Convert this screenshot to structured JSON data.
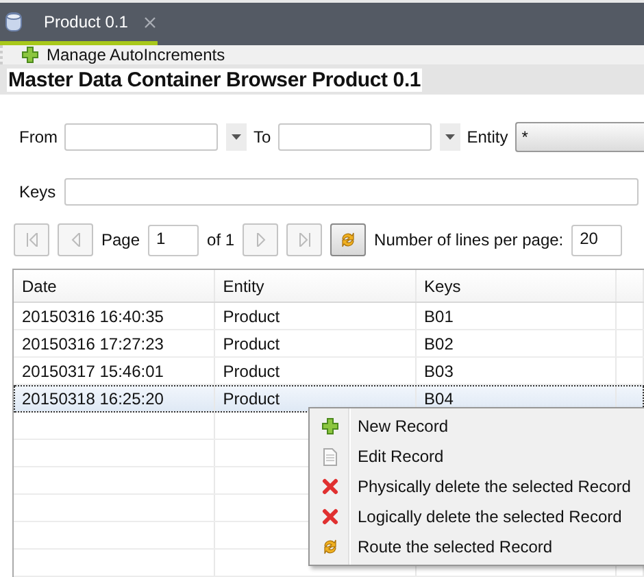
{
  "tab": {
    "label": "Product 0.1",
    "selected": true
  },
  "toolbar": {
    "label": "Manage AutoIncrements"
  },
  "title": "Master Data Container Browser Product 0.1",
  "filters": {
    "from_label": "From",
    "to_label": "To",
    "entity_label": "Entity",
    "entity_value": "*",
    "keys_label": "Keys"
  },
  "pager": {
    "page_label": "Page",
    "page_value": "1",
    "of_label": "of 1",
    "lines_label": "Number of lines per page:",
    "lines_value": "20"
  },
  "table": {
    "columns": [
      "Date",
      "Entity",
      "Keys"
    ],
    "rows": [
      {
        "cells": [
          "20150316 16:40:35",
          "Product",
          "B01"
        ],
        "selected": false
      },
      {
        "cells": [
          "20150316 17:27:23",
          "Product",
          "B02"
        ],
        "selected": false
      },
      {
        "cells": [
          "20150317 15:46:01",
          "Product",
          "B03"
        ],
        "selected": false
      },
      {
        "cells": [
          "20150318 16:25:20",
          "Product",
          "B04"
        ],
        "selected": true
      }
    ]
  },
  "context_menu": [
    {
      "kind": "new",
      "label": "New Record"
    },
    {
      "kind": "edit",
      "label": "Edit Record"
    },
    {
      "kind": "delete",
      "label": "Physically delete the selected Record"
    },
    {
      "kind": "delete",
      "label": "Logically delete the selected Record"
    },
    {
      "kind": "route",
      "label": "Route the selected Record"
    }
  ]
}
